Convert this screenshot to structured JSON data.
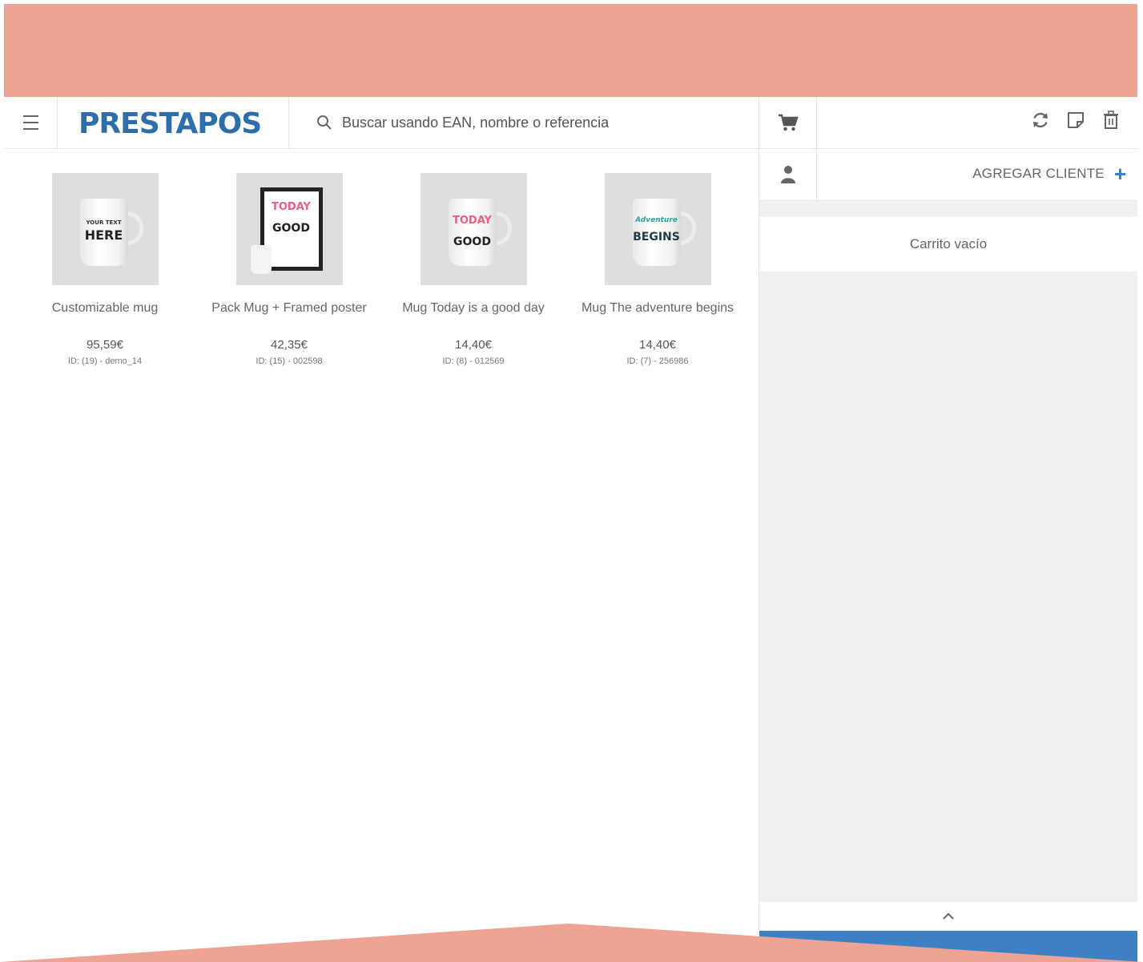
{
  "header": {
    "logo": "PRESTAPOS",
    "search_placeholder": "Buscar usando EAN, nombre o referencia"
  },
  "products": [
    {
      "name": "Customizable mug",
      "price": "95,59€",
      "ref": "ID: (19) - demo_14",
      "mug_text": [
        "YOUR TEXT",
        "HERE"
      ]
    },
    {
      "name": "Pack Mug + Framed poster",
      "price": "42,35€",
      "ref": "ID: (15) - 002598",
      "mug_text": [
        "TODAY",
        "GOOD"
      ]
    },
    {
      "name": "Mug Today is a good day",
      "price": "14,40€",
      "ref": "ID: (8) - 012569",
      "mug_text": [
        "TODAY",
        "GOOD"
      ]
    },
    {
      "name": "Mug The adventure begins",
      "price": "14,40€",
      "ref": "ID: (7) - 256986",
      "mug_text": [
        "Adventure",
        "BEGINS"
      ]
    }
  ],
  "cart": {
    "add_client_label": "AGREGAR CLIENTE",
    "add_client_plus": "+",
    "empty_message": "Carrito vacío"
  },
  "colors": {
    "brand_blue": "#2d6ea8",
    "accent_blue": "#3d80c4",
    "salmon": "#eea393"
  },
  "icons": [
    "menu-icon",
    "search-icon",
    "cart-icon",
    "refresh-icon",
    "note-icon",
    "trash-icon",
    "user-icon",
    "chevron-up-icon"
  ]
}
